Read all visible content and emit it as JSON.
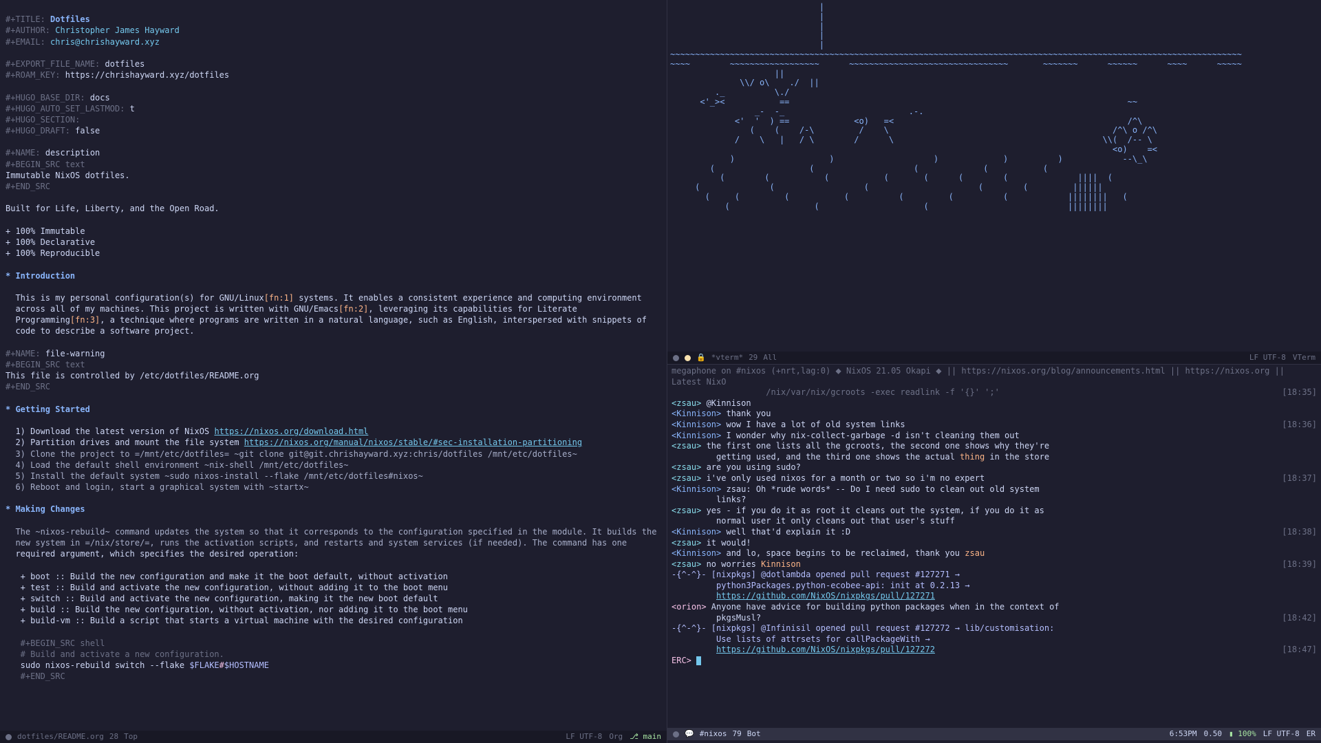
{
  "left": {
    "props": {
      "title_key": "#+TITLE:",
      "title_val": "Dotfiles",
      "author_key": "#+AUTHOR:",
      "author_val": "Christopher James Hayward",
      "email_key": "#+EMAIL:",
      "email_val": "chris@chrishayward.xyz",
      "export_key": "#+EXPORT_FILE_NAME:",
      "export_val": "dotfiles",
      "roam_key": "#+ROAM_KEY:",
      "roam_val": "https://chrishayward.xyz/dotfiles",
      "hugo_base_key": "#+HUGO_BASE_DIR:",
      "hugo_base_val": "docs",
      "hugo_lastmod_key": "#+HUGO_AUTO_SET_LASTMOD:",
      "hugo_lastmod_val": "t",
      "hugo_section_key": "#+HUGO_SECTION:",
      "hugo_draft_key": "#+HUGO_DRAFT:",
      "hugo_draft_val": "false",
      "name_desc_key": "#+NAME:",
      "name_desc_val": "description",
      "begin_src_text": "#+BEGIN_SRC text",
      "desc_body": "Immutable NixOS dotfiles.",
      "end_src": "#+END_SRC",
      "tagline": "Built for Life, Liberty, and the Open Road.",
      "bullet1": "+ 100% Immutable",
      "bullet2": "+ 100% Declarative",
      "bullet3": "+ 100% Reproducible"
    },
    "h_intro": "* Introduction",
    "intro1a": "  This is my personal configuration(s) for GNU/Linux",
    "intro1b": "[fn:1]",
    "intro1c": " systems. It enables a consistent experience and computing environment",
    "intro2a": "  across all of my machines. This project is written with GNU/Emacs",
    "intro2b": "[fn:2]",
    "intro2c": ", leveraging its capabilities for Literate",
    "intro3a": "  Programming",
    "intro3b": "[fn:3]",
    "intro3c": ", a technique where programs are written in a natural language, such as English, interspersed with snippets of",
    "intro4": "  code to describe a software project.",
    "warn_name_key": "#+NAME:",
    "warn_name_val": "file-warning",
    "warn_body": "This file is controlled by /etc/dotfiles/README.org",
    "h_started": "* Getting Started",
    "gs1a": "  1) Download the latest version of NixOS ",
    "gs1_link": "https://nixos.org/download.html",
    "gs2a": "  2) Partition drives and mount the file system ",
    "gs2_link": "https://nixos.org/manual/nixos/stable/#sec-installation-partitioning",
    "gs3": "  3) Clone the project to =/mnt/etc/dotfiles= ~git clone git@git.chrishayward.xyz:chris/dotfiles /mnt/etc/dotfiles~",
    "gs4": "  4) Load the default shell environment ~nix-shell /mnt/etc/dotfiles~",
    "gs5": "  5) Install the default system ~sudo nixos-install --flake /mnt/etc/dotfiles#nixos~",
    "gs6": "  6) Reboot and login, start a graphical system with ~startx~",
    "h_making": "* Making Changes",
    "mc1": "  The ~nixos-rebuild~ command updates the system so that it corresponds to the configuration specified in the module. It builds the",
    "mc2": "  new system in =/nix/store/=, runs the activation scripts, and restarts and system services (if needed). The command has one",
    "mc3": "  required argument, which specifies the desired operation:",
    "mc_b1": "   + boot :: Build the new configuration and make it the boot default, without activation",
    "mc_b2": "   + test :: Build and activate the new configuration, without adding it to the boot menu",
    "mc_b3": "   + switch :: Build and activate the new configuration, making it the new boot default",
    "mc_b4": "   + build :: Build the new configuration, without activation, nor adding it to the boot menu",
    "mc_b5": "   + build-vm :: Build a script that starts a virtual machine with the desired configuration",
    "mc_begin": "   #+BEGIN_SRC shell",
    "mc_comment": "   # Build and activate a new configuration.",
    "mc_cmd": "   sudo nixos-rebuild switch --flake ",
    "mc_flake": "$FLAKE",
    "mc_hash": "#",
    "mc_host": "$HOSTNAME",
    "mc_end": "   #+END_SRC"
  },
  "ml_left": {
    "file": "dotfiles/README.org",
    "rows": "28",
    "pos": "Top",
    "enc": "LF UTF-8",
    "mode": "Org",
    "git": "main"
  },
  "ml_topright": {
    "name": "*vterm*",
    "rows": "29",
    "pos": "All",
    "enc": "LF UTF-8",
    "mode": "VTerm"
  },
  "ml_botright": {
    "name": "#nixos",
    "rows": "79",
    "pos": "Bot",
    "time": "6:53PM",
    "load": "0.50",
    "batt": "100%",
    "enc": "LF UTF-8",
    "mode": "ER"
  },
  "irc": {
    "topic1": "megaphone on #nixos (+nrt,lag:0) ",
    "topic2": " NixOS 21.05 Okapi ",
    "topic3": " || https://nixos.org/blog/announcements.html || https://nixos.org || Latest NixO",
    "topic4": "                   /nix/var/nix/gcroots -exec readlink -f '{}' ';'",
    "t1": "[18:35]",
    "l1": {
      "n": "<zsau>",
      "t": " @Kinnison"
    },
    "l2": {
      "n": "<Kinnison>",
      "t": " thank you"
    },
    "l3": {
      "n": "<Kinnison>",
      "t": " wow I have a lot of old system links",
      "tm": "[18:36]"
    },
    "l4": {
      "n": "<Kinnison>",
      "t": " I wonder why nix-collect-garbage -d isn't cleaning them out"
    },
    "l5": {
      "n": "<zsau>",
      "t1": " the first one lists all the gcroots, the second one shows why they're"
    },
    "l5b": {
      "t": "         getting used, and the third one shows the actual ",
      "hi": "thing",
      "t2": " in the store"
    },
    "l6": {
      "n": "<zsau>",
      "t": " are you using sudo?"
    },
    "l7": {
      "n": "<zsau>",
      "t": " i've only used nixos for a month or two so i'm no expert",
      "tm": "[18:37]"
    },
    "l8": {
      "n": "<Kinnison>",
      "t": " zsau: Oh *rude words* -- Do I need sudo to clean out old system"
    },
    "l8b": {
      "t": "         links?"
    },
    "l9": {
      "n": "<zsau>",
      "t": " yes - if you do it as root it cleans out the system, if you do it as"
    },
    "l9b": {
      "t": "         normal user it only cleans out that user's stuff"
    },
    "l10": {
      "n": "<Kinnison>",
      "t": " well that'd explain it :D",
      "tm": "[18:38]"
    },
    "l11": {
      "n": "<zsau>",
      "t": " it would!"
    },
    "l12": {
      "n": "<Kinnison>",
      "t1": " and lo, space begins to be reclaimed, thank you ",
      "hi": "zsau"
    },
    "l13": {
      "n": "<zsau>",
      "t": " no worries ",
      "hi": "Kinnison",
      "tm": "[18:39]"
    },
    "l14": {
      "n": "-{^-^}-",
      "t": " [nixpkgs] @dotlambda opened pull request #127271 →"
    },
    "l14b": {
      "t": "         python3Packages.python-ecobee-api: init at 0.2.13 →"
    },
    "l14_link": "https://github.com/NixOS/nixpkgs/pull/127271",
    "l15": {
      "n": "<orion>",
      "t": " Anyone have advice for building python packages when in the context of"
    },
    "l15b": {
      "t": "         pkgsMusl?",
      "tm": "[18:42]"
    },
    "l16": {
      "n": "-{^-^}-",
      "t": " [nixpkgs] @Infinisil opened pull request #127272 → lib/customisation:"
    },
    "l16b": {
      "t": "         Use lists of attrsets for callPackageWith →"
    },
    "l16_link": "https://github.com/NixOS/nixpkgs/pull/127272",
    "l16_tm": "[18:47]",
    "prompt": "ERC> "
  },
  "art_lines": [
    "                              |",
    "                              |",
    "                              |",
    "                              |",
    "                              |",
    "~~~~~~~~~~~~~~~~~~~~~~~~~~~~~~~~~~~~~~~~~~~~~~~~~~~~~~~~~~~~~~~~~~~~~~~~~~~~~~~~~~~~~~~~~~~~~~~~~~~~~~~~~~~~~~~~~~~",
    "~~~~        ~~~~~~~~~~~~~~~~~~      ~~~~~~~~~~~~~~~~~~~~~~~~~~~~~~~~       ~~~~~~~      ~~~~~~      ~~~~      ~~~~~",
    "                     ||",
    "              \\\\/ o\\    ./  ||",
    "         ._          \\./",
    "      <'_><           ==                                                                    ~~",
    "                 _-  -_                         .-.",
    "             <'  '  ) ==             <o)   =<                                               /^\\",
    "                (    (    /-\\         /    \\                                             /^\\ o /^\\",
    "             /    \\   |   / \\        /      \\                                          \\\\(  /-- \\",
    "                                                                                         <o)    =<",
    "            )                   )                    )             )          )            --\\_\\",
    "        (                   (                    (             (           (",
    "          (        (           (           (       (      (        (              ||||  (",
    "     (              (                  (                      (        (         ||||||  ",
    "       (     (         (           (          (         (          (            ||||||||   (",
    "           (                 (                     (                            ||||||||"
  ]
}
